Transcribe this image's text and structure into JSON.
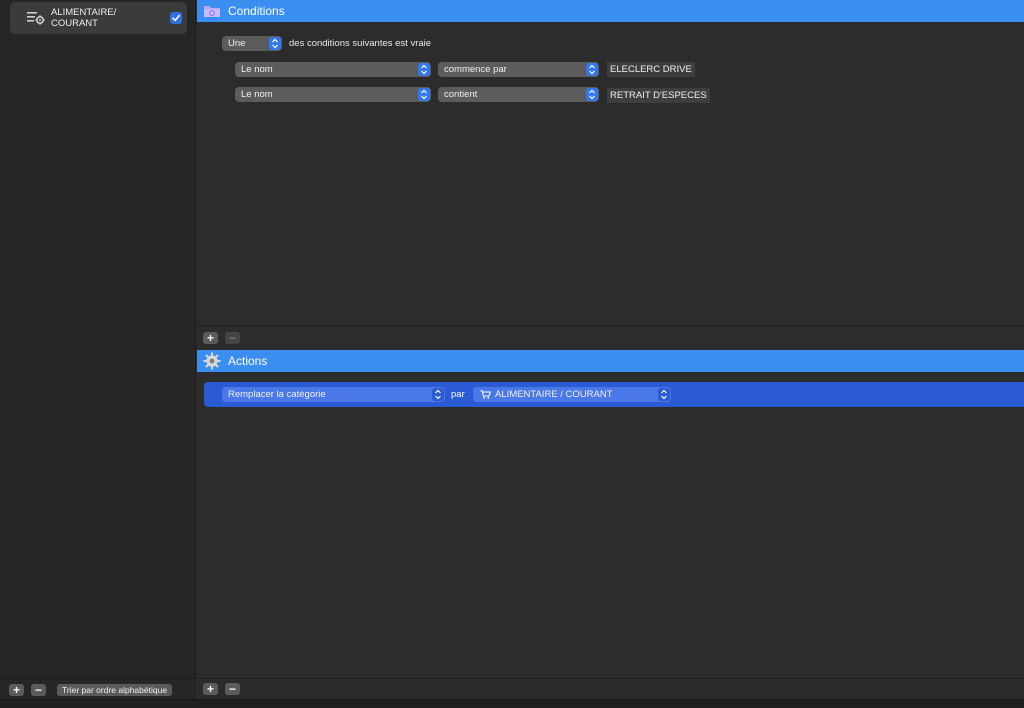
{
  "sidebar": {
    "rules": [
      {
        "label": "ALIMENTAIRE/\nCOURANT",
        "enabled": true,
        "icon": "rule-gear-icon"
      }
    ],
    "footer": {
      "add_label": "+",
      "remove_label": "−",
      "sort_label": "Trier par ordre alphabétique"
    }
  },
  "conditions": {
    "header": "Conditions",
    "header_icon": "folder-icon",
    "match": {
      "selected": "Une",
      "suffix": "des conditions suivantes est vraie"
    },
    "rows": [
      {
        "field": "Le nom",
        "operator": "commence par",
        "value": "ELECLERC DRIVE"
      },
      {
        "field": "Le nom",
        "operator": "contient",
        "value": "RETRAIT D'ESPECES"
      }
    ],
    "footer": {
      "add_label": "+",
      "remove_label": "−"
    }
  },
  "actions": {
    "header": "Actions",
    "header_icon": "gear-icon",
    "rows": [
      {
        "action": "Remplacer la catégorie",
        "connector": "par",
        "target": "ALIMENTAIRE / COURANT",
        "target_icon": "cart-icon"
      }
    ],
    "footer": {
      "add_label": "+",
      "remove_label": "−"
    }
  },
  "colors": {
    "accent": "#3a8ef0",
    "selection": "#2a5bd4",
    "background": "#2c2c2c"
  }
}
